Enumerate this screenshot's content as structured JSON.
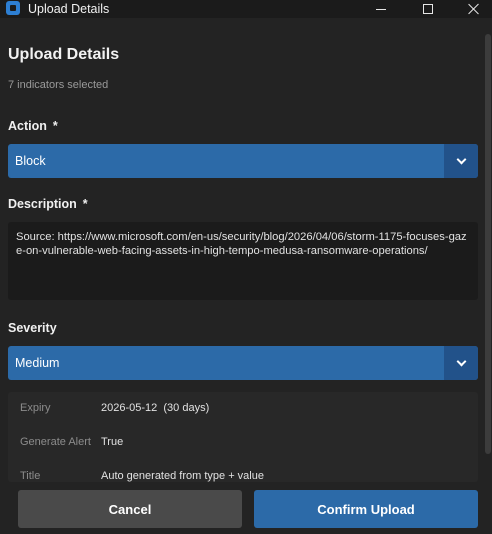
{
  "window": {
    "title": "Upload Details"
  },
  "header": {
    "title": "Upload Details",
    "subtitle": "7 indicators selected"
  },
  "action": {
    "label": "Action",
    "required_mark": "*",
    "value": "Block"
  },
  "description": {
    "label": "Description",
    "required_mark": "*",
    "text": "Source: https://www.microsoft.com/en-us/security/blog/2026/04/06/storm-1175-focuses-gaze-on-vulnerable-web-facing-assets-in-high-tempo-medusa-ransomware-operations/"
  },
  "severity": {
    "label": "Severity",
    "value": "Medium"
  },
  "summary": {
    "rows": [
      {
        "key": "Expiry",
        "value": "2026-05-12  (30 days)"
      },
      {
        "key": "Generate Alert",
        "value": "True"
      },
      {
        "key": "Title",
        "value": "Auto generated from type + value"
      }
    ]
  },
  "footer": {
    "cancel_label": "Cancel",
    "confirm_label": "Confirm Upload"
  },
  "colors": {
    "accent": "#2c6aa8",
    "background": "#232323"
  }
}
